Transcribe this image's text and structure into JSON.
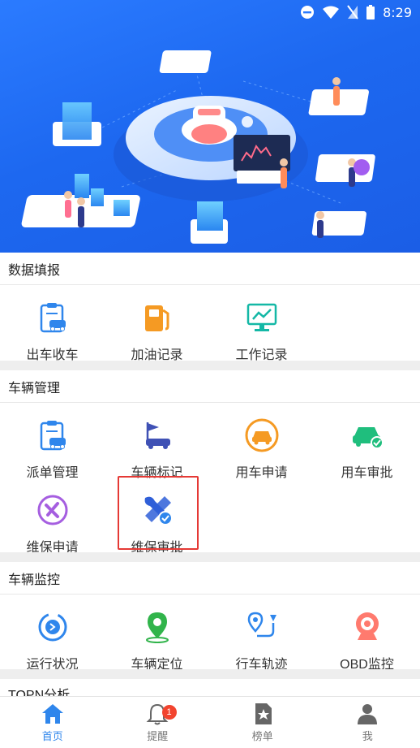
{
  "status_bar": {
    "time": "8:29"
  },
  "sections": [
    {
      "title": "数据填报",
      "items": [
        {
          "label": "出车收车",
          "icon": "clipboard-car-icon"
        },
        {
          "label": "加油记录",
          "icon": "fuel-pump-icon"
        },
        {
          "label": "工作记录",
          "icon": "monitor-chart-icon"
        }
      ]
    },
    {
      "title": "车辆管理",
      "items": [
        {
          "label": "派单管理",
          "icon": "clipboard-car-icon"
        },
        {
          "label": "车辆标记",
          "icon": "flag-car-icon"
        },
        {
          "label": "用车申请",
          "icon": "car-circle-icon"
        },
        {
          "label": "用车审批",
          "icon": "car-check-icon"
        },
        {
          "label": "维保申请",
          "icon": "tools-circle-icon"
        },
        {
          "label": "维保审批",
          "icon": "wrench-check-icon"
        }
      ]
    },
    {
      "title": "车辆监控",
      "items": [
        {
          "label": "运行状况",
          "icon": "run-status-icon"
        },
        {
          "label": "车辆定位",
          "icon": "location-pin-icon"
        },
        {
          "label": "行车轨迹",
          "icon": "route-icon"
        },
        {
          "label": "OBD监控",
          "icon": "webcam-icon"
        }
      ]
    },
    {
      "title": "TOPN分析"
    }
  ],
  "bottom_nav": [
    {
      "label": "首页",
      "icon": "home-icon",
      "active": true
    },
    {
      "label": "提醒",
      "icon": "bell-icon",
      "badge": "1"
    },
    {
      "label": "榜单",
      "icon": "ranking-icon"
    },
    {
      "label": "我",
      "icon": "person-icon"
    }
  ],
  "colors": {
    "accent_blue": "#2f86ec",
    "orange": "#f59a23",
    "green": "#1fbe7d",
    "teal": "#14b8a6",
    "purple": "#a55ee0",
    "red_badge": "#f2442f",
    "highlight_border": "#e53935"
  }
}
